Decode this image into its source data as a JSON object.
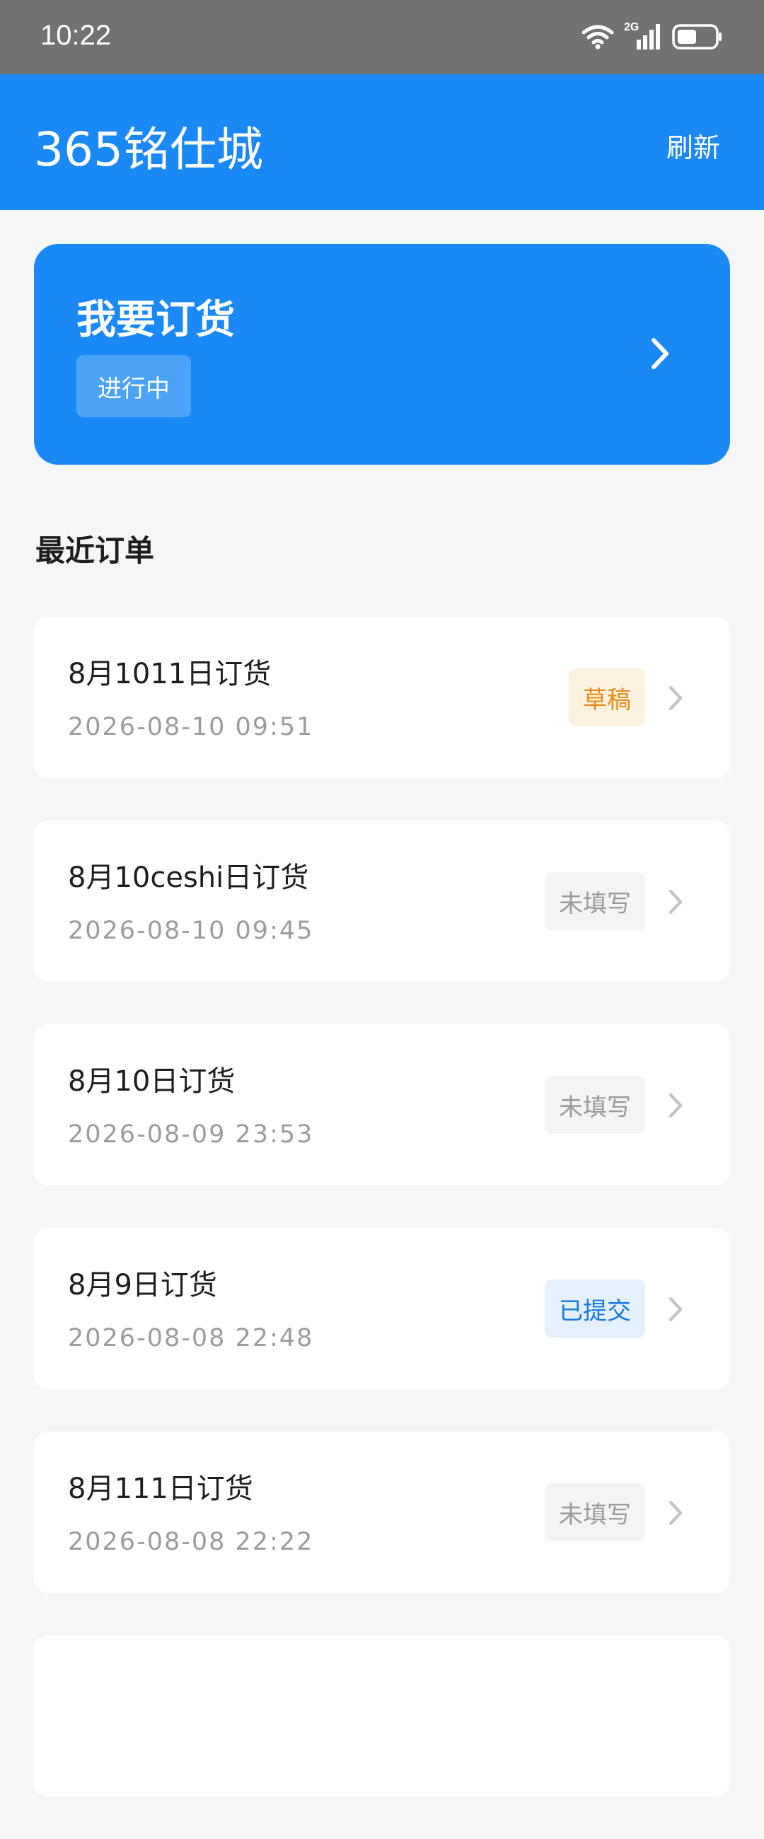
{
  "status_bar": {
    "time": "10:22",
    "network": "2G"
  },
  "app_bar": {
    "title": "365铭仕城",
    "refresh_label": "刷新"
  },
  "order_card": {
    "title": "我要订货",
    "badge": "进行中"
  },
  "recent": {
    "section_title": "最近订单",
    "orders": [
      {
        "title": "8月1011日订货",
        "time": "2026-08-10 09:51",
        "status": "草稿",
        "status_type": "draft"
      },
      {
        "title": "8月10ceshi日订货",
        "time": "2026-08-10 09:45",
        "status": "未填写",
        "status_type": "empty"
      },
      {
        "title": "8月10日订货",
        "time": "2026-08-09 23:53",
        "status": "未填写",
        "status_type": "empty"
      },
      {
        "title": "8月9日订货",
        "time": "2026-08-08 22:48",
        "status": "已提交",
        "status_type": "submitted"
      },
      {
        "title": "8月111日订货",
        "time": "2026-08-08 22:22",
        "status": "未填写",
        "status_type": "empty"
      }
    ]
  },
  "colors": {
    "primary": "#1a88f5",
    "status_bar": "#727272",
    "background": "#f5f6f8"
  }
}
